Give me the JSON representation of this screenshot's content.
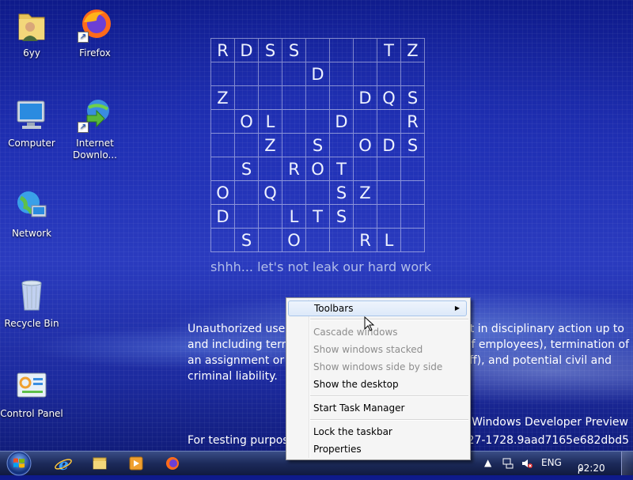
{
  "desktop_icons": [
    {
      "label": "6yy",
      "icon": "user-folder-icon"
    },
    {
      "label": "Firefox",
      "icon": "firefox-icon"
    },
    {
      "label": "Computer",
      "icon": "computer-icon"
    },
    {
      "label": "Internet Downlo...",
      "icon": "internet-download-manager-icon"
    },
    {
      "label": "Network",
      "icon": "network-icon"
    },
    {
      "label": "Recycle Bin",
      "icon": "recycle-bin-icon"
    },
    {
      "label": "Control Panel",
      "icon": "control-panel-icon"
    }
  ],
  "puzzle": {
    "rows": [
      [
        "R",
        "D",
        "S",
        "S",
        "",
        "",
        "",
        "T",
        "Z"
      ],
      [
        "",
        "",
        "",
        "",
        "D",
        "",
        "",
        "",
        ""
      ],
      [
        "Z",
        "",
        "",
        "",
        "",
        "",
        "D",
        "Q",
        "S"
      ],
      [
        "",
        "O",
        "L",
        "",
        "",
        "D",
        "",
        "",
        "R"
      ],
      [
        "",
        "",
        "Z",
        "",
        "S",
        "",
        "O",
        "D",
        "S"
      ],
      [
        "",
        "S",
        "",
        "R",
        "O",
        "T",
        "",
        "",
        ""
      ],
      [
        "O",
        "",
        "Q",
        "",
        "",
        "S",
        "Z",
        "",
        ""
      ],
      [
        "D",
        "",
        "",
        "L",
        "T",
        "S",
        "",
        "",
        ""
      ],
      [
        "",
        "S",
        "",
        "O",
        "",
        "",
        "R",
        "L",
        ""
      ]
    ],
    "tagline": "shhh... let's not leak our hard work"
  },
  "notice": {
    "line1": "Unauthorized use c",
    "line1_right": "ult in disciplinary action up to",
    "line2": "and including term",
    "line2_right": "of employees), termination of",
    "line3": "an assignment or c",
    "line3_right": "aff), and potential civil and",
    "line4": "criminal liability."
  },
  "watermark": {
    "preview": "Windows Developer Preview",
    "build_left": "For testing purpose",
    "build_right": "0727-1728.9aad7165e682dbd5"
  },
  "context_menu": {
    "items": [
      {
        "label": "Toolbars",
        "submenu": true,
        "enabled": true
      },
      {
        "label": "Cascade windows",
        "enabled": false
      },
      {
        "label": "Show windows stacked",
        "enabled": false
      },
      {
        "label": "Show windows side by side",
        "enabled": false
      },
      {
        "label": "Show the desktop",
        "enabled": true
      },
      {
        "label": "Start Task Manager",
        "enabled": true
      },
      {
        "label": "Lock the taskbar",
        "enabled": true
      },
      {
        "label": "Properties",
        "enabled": true
      }
    ]
  },
  "taskbar": {
    "pinned": [
      "internet-explorer-icon",
      "file-explorer-icon",
      "media-player-icon",
      "firefox-icon"
    ],
    "tray": {
      "language": "ENG",
      "time": "02:20",
      "ampm": "م"
    }
  },
  "colors": {
    "desktop_bg": "#1f2fb3",
    "menu_bg": "#f5f5f5",
    "menu_hover": "#dde9f9",
    "disabled_text": "#8d8d8d"
  }
}
